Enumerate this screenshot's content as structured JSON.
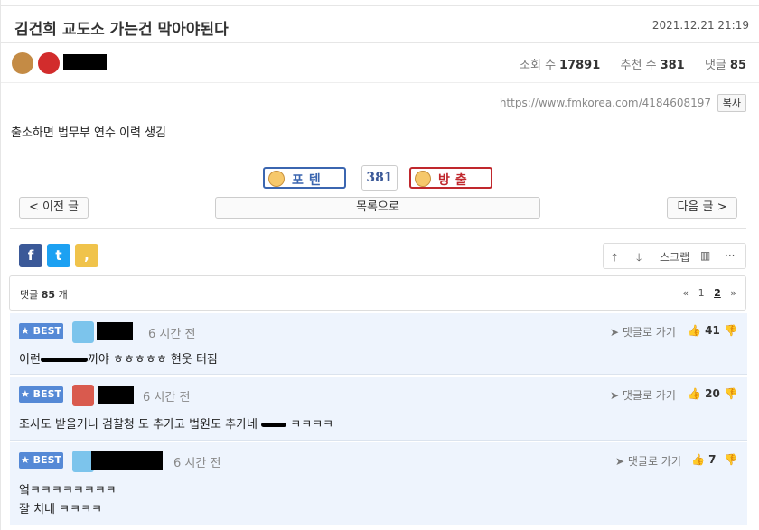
{
  "post": {
    "title": "김건희 교도소 가는건 막아야된다",
    "datetime": "2021.12.21 21:19"
  },
  "stats": {
    "views_label": "조회 수",
    "views": "17891",
    "recommend_label": "추천 수",
    "recommend": "381",
    "comments_label": "댓글",
    "comments": "85"
  },
  "share_url": "https://www.fmkorea.com/4184608197",
  "copy_label": "복사",
  "body": "출소하면 법무부 연수 이력 생김",
  "votes": {
    "up_label": "포텐",
    "count": "381",
    "down_label": "방출"
  },
  "nav": {
    "prev": "< 이전 글",
    "list": "목록으로",
    "next": "다음 글 >"
  },
  "tools": {
    "scrap": "스크랩"
  },
  "share_buttons": {
    "facebook": "f",
    "twitter": "t",
    "kakao": ","
  },
  "comment_header": {
    "prefix": "댓글",
    "count": "85",
    "suffix": "개",
    "pages": [
      "1",
      "2"
    ],
    "current_page": "2"
  },
  "comments": [
    {
      "badge": "★ BEST",
      "time": "6 시간 전",
      "reply": "댓글로 가기",
      "likes": "41",
      "text_before": "이런",
      "text_after": "끼야 ㅎㅎㅎㅎㅎ 현웃 터짐"
    },
    {
      "badge": "★ BEST",
      "time": "6 시간 전",
      "reply": "댓글로 가기",
      "likes": "20",
      "text_before": "조사도 받을거니 검찰청 도 추가고 법원도 추가네",
      "text_after": "ㅋㅋㅋㅋ"
    },
    {
      "badge": "★ BEST",
      "time": "6 시간 전",
      "reply": "댓글로 가기",
      "likes": "7",
      "text_line1": "엌ㅋㅋㅋㅋㅋㅋㅋㅋ",
      "text_line2": "잘 치네 ㅋㅋㅋㅋ"
    }
  ]
}
